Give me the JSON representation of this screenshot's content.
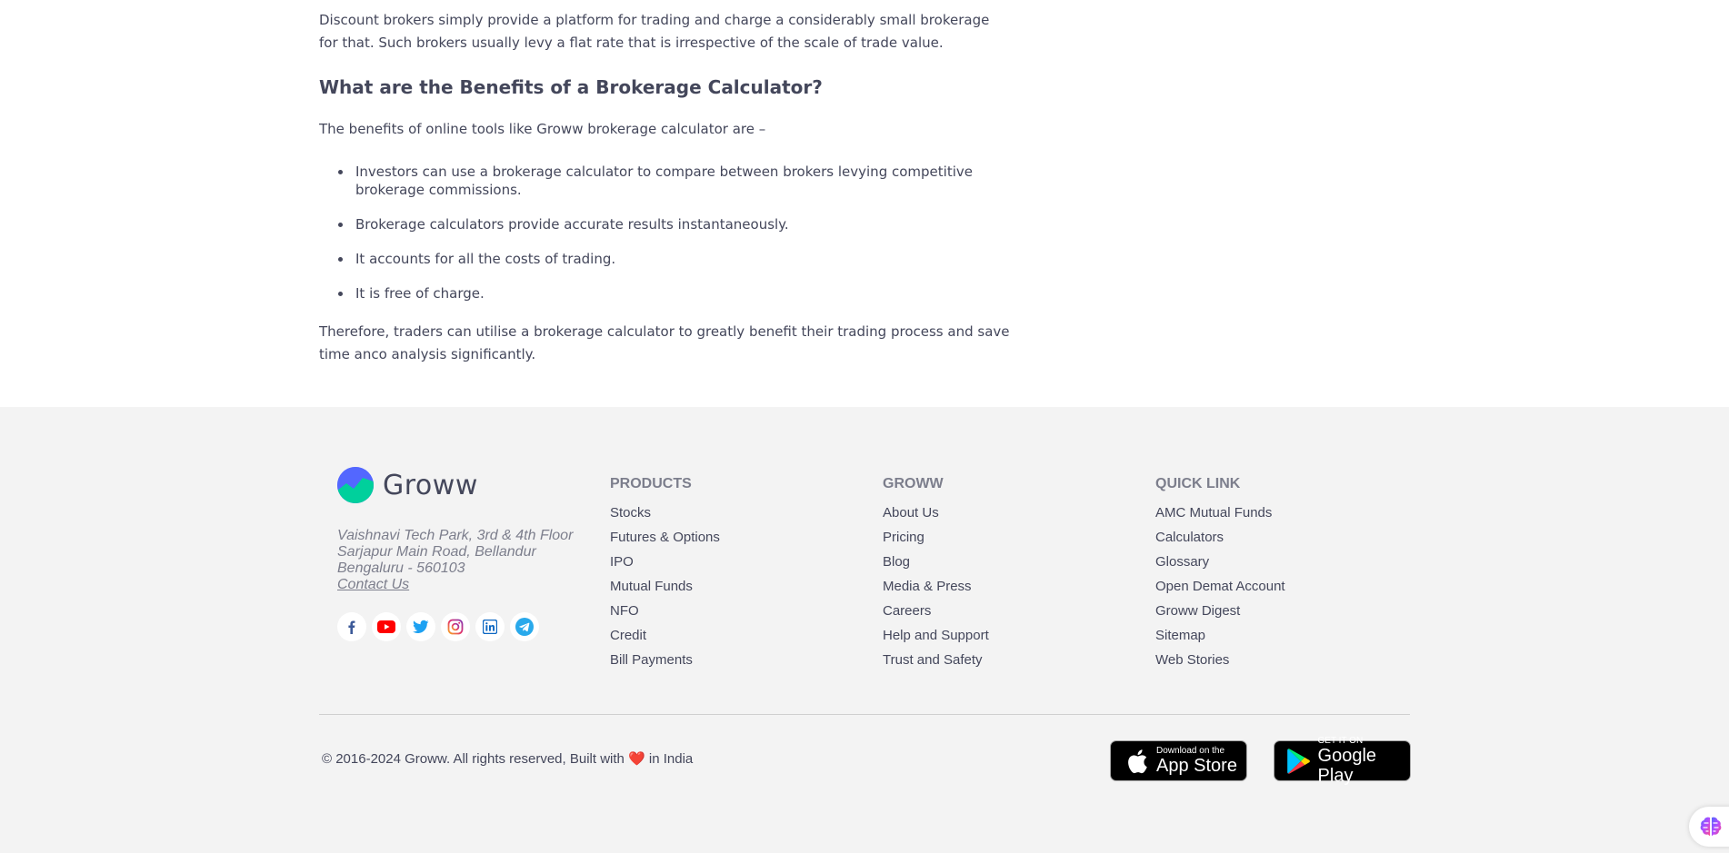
{
  "article": {
    "intro": "Discount brokers simply provide a platform for trading and charge a considerably small brokerage for that. Such brokers usually levy a flat rate that is irrespective of the scale of trade value.",
    "benefits_heading": "What are the Benefits of a Brokerage Calculator?",
    "benefits_intro": "The benefits of online tools like Groww brokerage calculator are –",
    "benefits": [
      "Investors can use a brokerage calculator to compare between brokers levying competitive brokerage commissions.",
      "Brokerage calculators provide accurate results instantaneously.",
      "It accounts for all the costs of trading.",
      "It is free of charge."
    ],
    "conclusion": "Therefore, traders can utilise a brokerage calculator to greatly benefit their trading process and save time anco analysis significantly."
  },
  "footer": {
    "brand_name": "Groww",
    "address": {
      "line1": "Vaishnavi Tech Park, 3rd & 4th Floor",
      "line2": "Sarjapur Main Road, Bellandur",
      "line3": "Bengaluru - 560103",
      "contact": "Contact Us"
    },
    "socials": [
      "facebook-icon",
      "youtube-icon",
      "twitter-icon",
      "instagram-icon",
      "linkedin-icon",
      "telegram-icon"
    ],
    "products": {
      "heading": "PRODUCTS",
      "items": [
        "Stocks",
        "Futures & Options",
        "IPO",
        "Mutual Funds",
        "NFO",
        "Credit",
        "Bill Payments"
      ]
    },
    "groww": {
      "heading": "GROWW",
      "items": [
        "About Us",
        "Pricing",
        "Blog",
        "Media & Press",
        "Careers",
        "Help and Support",
        "Trust and Safety"
      ]
    },
    "quick": {
      "heading": "QUICK LINK",
      "items": [
        "AMC Mutual Funds",
        "Calculators",
        "Glossary",
        "Open Demat Account",
        "Groww Digest",
        "Sitemap",
        "Web Stories"
      ]
    },
    "copyright_pre": "© 2016-2024 Groww. All rights reserved, Built with",
    "copyright_heart": "❤️",
    "copyright_post": "in India",
    "app_store": {
      "small": "Download on the",
      "big": "App Store"
    },
    "google_play": {
      "small": "GET IT ON",
      "big": "Google Play"
    }
  },
  "colors": {
    "text": "#44475b",
    "muted": "#7c7e8c",
    "footer_bg": "#f3f3f3",
    "brand_blue": "#5367ff",
    "brand_green": "#00d09c"
  }
}
